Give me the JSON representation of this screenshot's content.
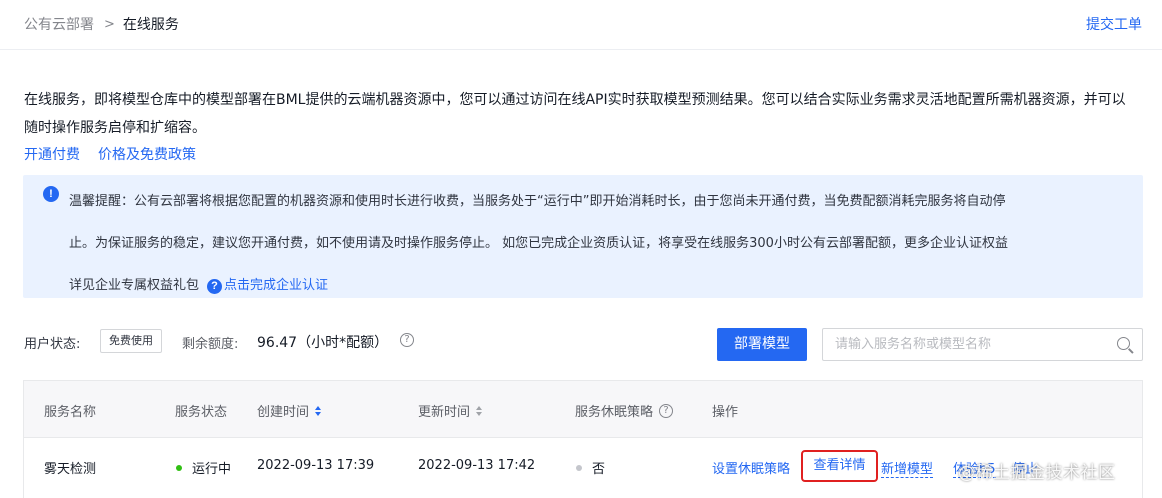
{
  "breadcrumb": {
    "parent": "公有云部署",
    "current": "在线服务"
  },
  "header": {
    "ticket_link": "提交工单"
  },
  "description": "在线服务，即将模型仓库中的模型部署在BML提供的云端机器资源中，您可以通过访问在线API实时获取模型预测结果。您可以结合实际业务需求灵活地配置所需机器资源，并可以随时操作服务启停和扩缩容。",
  "links": {
    "open_billing": "开通付费",
    "pricing": "价格及免费政策"
  },
  "notice": {
    "line1": "温馨提醒：公有云部署将根据您配置的机器资源和使用时长进行收费，当服务处于“运行中”即开始消耗时长，由于您尚未开通付费，当免费配额消耗完服务将自动停",
    "line2": "止。为保证服务的稳定，建议您开通付费，如不使用请及时操作服务停止。 如您已完成企业资质认证，将享受在线服务300小时公有云部署配额，更多企业认证权益",
    "line3": "详见企业专属权益礼包",
    "auth_link": "点击完成企业认证"
  },
  "status": {
    "user_status_label": "用户状态:",
    "user_status_tag": "免费使用",
    "quota_label": "剩余额度:",
    "quota_value": "96.47（小时*配额）"
  },
  "toolbar": {
    "deploy_button": "部署模型",
    "search_placeholder": "请输入服务名称或模型名称"
  },
  "table": {
    "headers": {
      "name": "服务名称",
      "status": "服务状态",
      "created": "创建时间",
      "updated": "更新时间",
      "sleep_policy": "服务休眠策略",
      "actions": "操作"
    },
    "rows": [
      {
        "name": "雾天检测",
        "status": "运行中",
        "created": "2022-09-13 17:39",
        "updated": "2022-09-13 17:42",
        "sleep_policy": "否",
        "actions": {
          "set_sleep": "设置休眠策略",
          "view_detail": "查看详情",
          "add_model": "新增模型",
          "try_h5": "体验h5",
          "stop": "停止"
        }
      }
    ]
  },
  "watermark": "@稀土掘金技术社区",
  "colors": {
    "primary": "#2468f2",
    "running": "#30bf13",
    "highlight_box": "#e02020",
    "notice_bg": "#eaf2ff"
  }
}
